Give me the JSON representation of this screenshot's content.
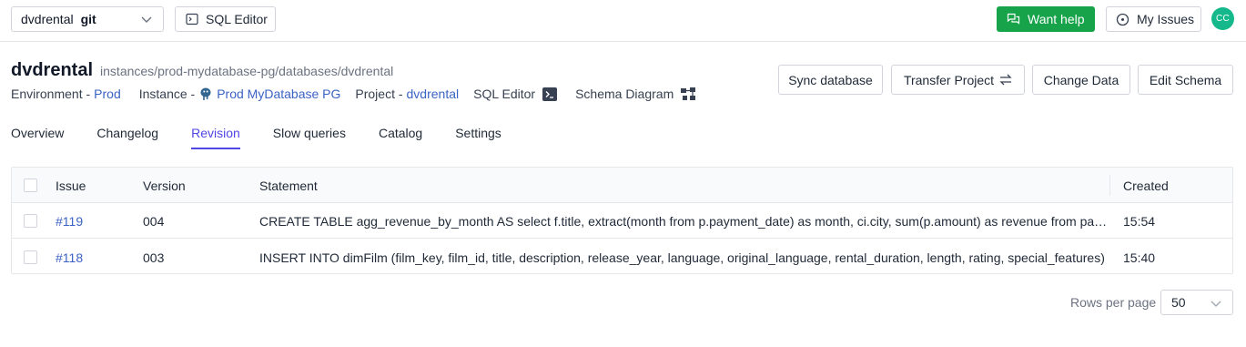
{
  "topbar": {
    "database_name": "dvdrental",
    "database_tag": "git",
    "sql_editor_label": "SQL Editor",
    "want_help_label": "Want help",
    "my_issues_label": "My Issues",
    "avatar_initials": "CC",
    "help_color": "#16a34a",
    "avatar_color": "#14b88a"
  },
  "header": {
    "title": "dvdrental",
    "path": "instances/prod-mydatabase-pg/databases/dvdrental",
    "environment_label": "Environment - ",
    "environment_value": "Prod",
    "instance_label": "Instance - ",
    "instance_value": "Prod MyDatabase PG",
    "project_label": "Project - ",
    "project_value": "dvdrental",
    "sql_editor_link": "SQL Editor",
    "schema_diagram_link": "Schema Diagram"
  },
  "actions": {
    "sync": "Sync database",
    "transfer": "Transfer Project",
    "change_data": "Change Data",
    "edit_schema": "Edit Schema"
  },
  "tabs": [
    {
      "label": "Overview",
      "active": false
    },
    {
      "label": "Changelog",
      "active": false
    },
    {
      "label": "Revision",
      "active": true
    },
    {
      "label": "Slow queries",
      "active": false
    },
    {
      "label": "Catalog",
      "active": false
    },
    {
      "label": "Settings",
      "active": false
    }
  ],
  "table": {
    "columns": {
      "issue": "Issue",
      "version": "Version",
      "statement": "Statement",
      "created": "Created"
    },
    "rows": [
      {
        "issue": "#119",
        "version": "004",
        "statement": "CREATE TABLE agg_revenue_by_month AS select f.title, extract(month from p.payment_date) as month, ci.city, sum(p.amount) as revenue from payment p join rental r on p.rental_id = r.rental_id",
        "created": "15:54"
      },
      {
        "issue": "#118",
        "version": "003",
        "statement": "INSERT INTO dimFilm (film_key, film_id, title, description, release_year, language, original_language, rental_duration, length, rating, special_features)",
        "created": "15:40"
      }
    ]
  },
  "pagination": {
    "rows_per_page_label": "Rows per page",
    "rows_per_page_value": "50"
  },
  "colors": {
    "link": "#3b63c4",
    "active_tab": "#4f46e5"
  }
}
